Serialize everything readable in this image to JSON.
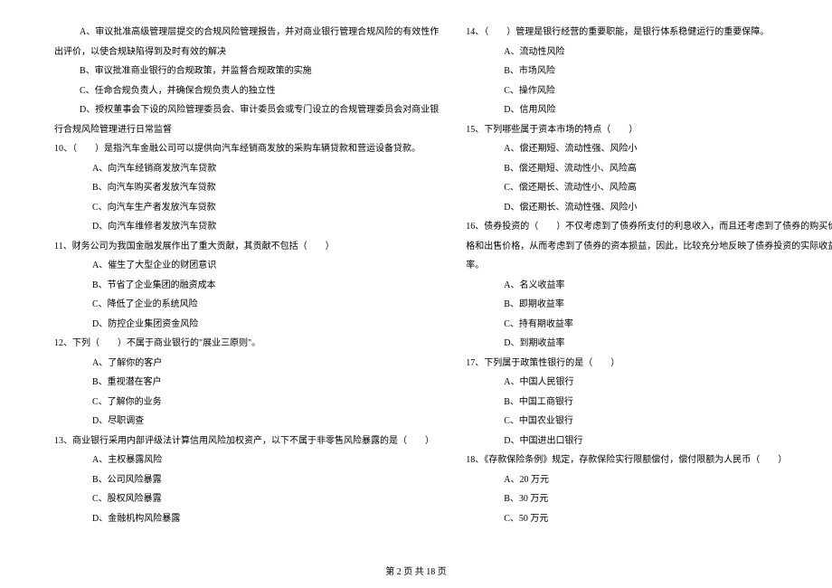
{
  "left_column": {
    "q9": {
      "opt_a_line1": "A、审议批准高级管理层提交的合规风险管理报告，并对商业银行管理合规风险的有效性作",
      "opt_a_line2": "出评价，以使合规缺陷得到及时有效的解决",
      "opt_b": "B、审议批准商业银行的合规政策，并监督合规政策的实施",
      "opt_c": "C、任命合规负责人，并确保合规负责人的独立性",
      "opt_d_line1": "D、授权董事会下设的风险管理委员会、审计委员会或专门设立的合规管理委员会对商业银",
      "opt_d_line2": "行合规风险管理进行日常监督"
    },
    "q10": {
      "stem": "10、（　　）是指汽车金融公司可以提供向汽车经销商发放的采购车辆贷款和营运设备贷款。",
      "opt_a": "A、向汽车经销商发放汽车贷款",
      "opt_b": "B、向汽车购买者发放汽车贷款",
      "opt_c": "C、向汽车生产者发放汽车贷款",
      "opt_d": "D、向汽车维修者发放汽车贷款"
    },
    "q11": {
      "stem": "11、财务公司为我国金融发展作出了重大贡献，其贡献不包括（　　）",
      "opt_a": "A、催生了大型企业的财团意识",
      "opt_b": "B、节省了企业集团的融资成本",
      "opt_c": "C、降低了企业的系统风险",
      "opt_d": "D、防控企业集团资金风险"
    },
    "q12": {
      "stem": "12、下列（　　）不属于商业银行的\"展业三原则\"。",
      "opt_a": "A、了解你的客户",
      "opt_b": "B、重视潜在客户",
      "opt_c": "C、了解你的业务",
      "opt_d": "D、尽职调查"
    },
    "q13": {
      "stem": "13、商业银行采用内部评级法计算信用风险加权资产，以下不属于非零售风险暴露的是（　　）",
      "opt_a": "A、主权暴露风险",
      "opt_b": "B、公司风险暴露",
      "opt_c": "C、股权风险暴露",
      "opt_d": "D、金融机构风险暴露"
    }
  },
  "right_column": {
    "q14": {
      "stem": "14、（　　）管理是银行经营的重要职能，是银行体系稳健运行的重要保障。",
      "opt_a": "A、流动性风险",
      "opt_b": "B、市场风险",
      "opt_c": "C、操作风险",
      "opt_d": "D、信用风险"
    },
    "q15": {
      "stem": "15、下列哪些属于资本市场的特点（　　）",
      "opt_a": "A、偿还期短、流动性强、风险小",
      "opt_b": "B、偿还期短、流动性小、风险高",
      "opt_c": "C、偿还期长、流动性小、风险高",
      "opt_d": "D、偿还期长、流动性强、风险小"
    },
    "q16": {
      "stem_line1": "16、债券投资的（　　）不仅考虑到了债券所支付的利息收入，而且还考虑到了债券的购买价",
      "stem_line2": "格和出售价格，从而考虑到了债券的资本损益，因此，比较充分地反映了债券投资的实际收益",
      "stem_line3": "率。",
      "opt_a": "A、名义收益率",
      "opt_b": "B、即期收益率",
      "opt_c": "C、持有期收益率",
      "opt_d": "D、到期收益率"
    },
    "q17": {
      "stem": "17、下列属于政策性银行的是（　　）",
      "opt_a": "A、中国人民银行",
      "opt_b": "B、中国工商银行",
      "opt_c": "C、中国农业银行",
      "opt_d": "D、中国进出口银行"
    },
    "q18": {
      "stem": "18、《存款保险条例》规定，存款保险实行限额偿付，偿付限额为人民币（　　）",
      "opt_a": "A、20 万元",
      "opt_b": "B、30 万元",
      "opt_c": "C、50 万元"
    }
  },
  "footer": "第 2 页 共 18 页"
}
